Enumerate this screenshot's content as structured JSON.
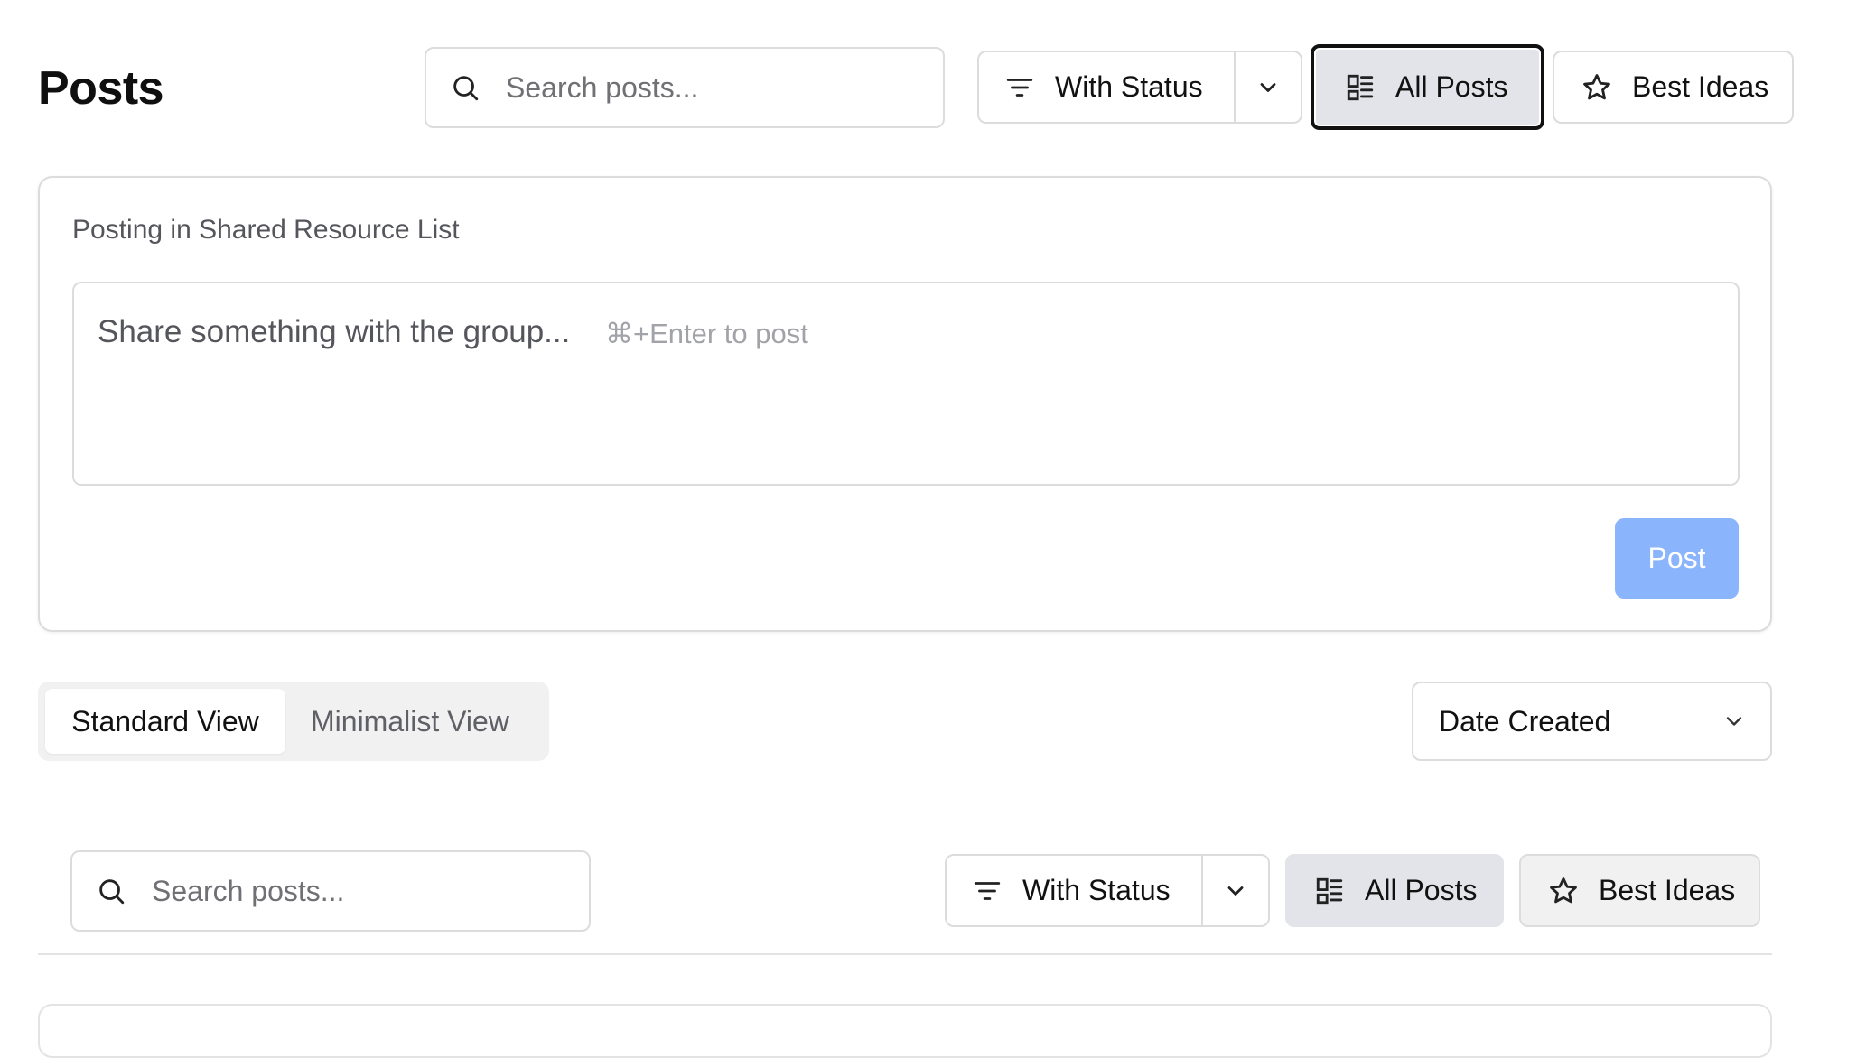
{
  "page": {
    "title": "Posts"
  },
  "top_toolbar": {
    "search_placeholder": "Search posts...",
    "status_filter_label": "With Status",
    "all_posts_label": "All Posts",
    "best_ideas_label": "Best Ideas"
  },
  "composer": {
    "context_label": "Posting in Shared Resource List",
    "placeholder": "Share something with the group...",
    "shortcut_hint": "⌘+Enter to post",
    "post_button": "Post"
  },
  "view_toggle": {
    "standard": "Standard View",
    "minimalist": "Minimalist View",
    "selected": "Standard View"
  },
  "sort": {
    "selected": "Date Created"
  },
  "lower_toolbar": {
    "search_placeholder": "Search posts...",
    "status_filter_label": "With Status",
    "all_posts_label": "All Posts",
    "best_ideas_label": "Best Ideas"
  },
  "colors": {
    "post_button": "#8ab4fb",
    "active_toggle": "#e2e4e9",
    "border": "#dcdcde"
  },
  "icons": [
    "search-icon",
    "filter-icon",
    "chevron-down-icon",
    "list-icon",
    "star-icon"
  ]
}
